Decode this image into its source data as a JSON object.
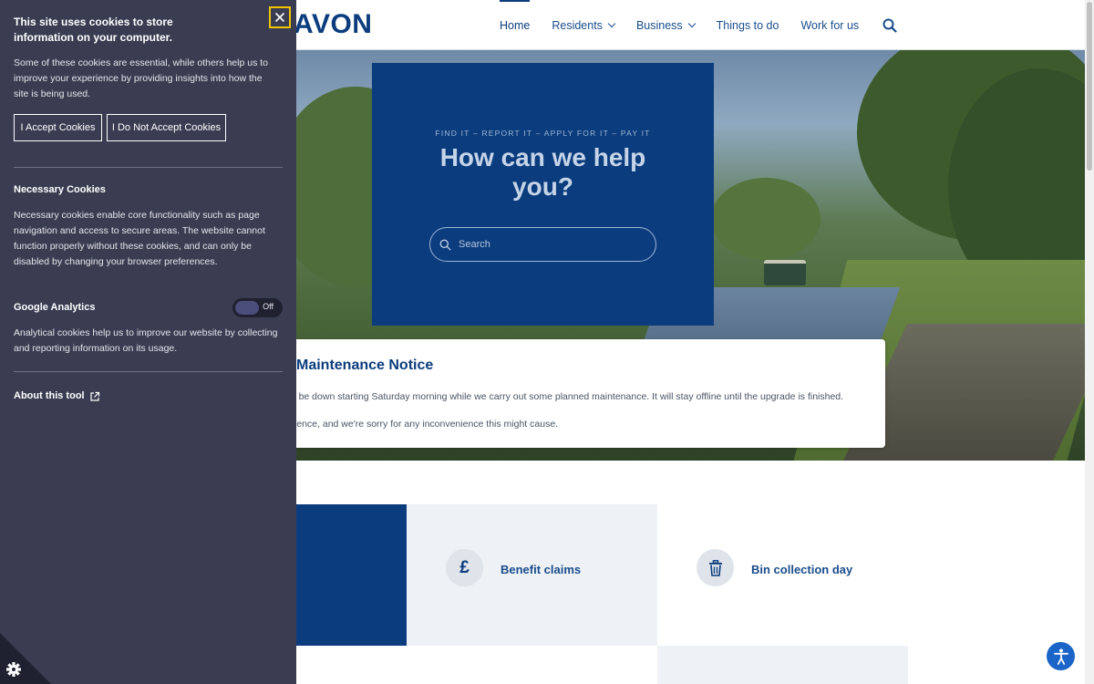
{
  "header": {
    "logo_text": "AVON",
    "nav": [
      {
        "label": "Home",
        "dropdown": false,
        "active": true
      },
      {
        "label": "Residents",
        "dropdown": true,
        "active": false
      },
      {
        "label": "Business",
        "dropdown": true,
        "active": false
      },
      {
        "label": "Things to do",
        "dropdown": false,
        "active": false
      },
      {
        "label": "Work for us",
        "dropdown": false,
        "active": false
      }
    ],
    "search_icon": "search-icon"
  },
  "hero": {
    "eyebrow": "FIND IT – REPORT IT – APPLY FOR IT – PAY IT",
    "title": "How can we help you?",
    "search_placeholder": "Search"
  },
  "notice": {
    "title": "Maintenance Notice",
    "paragraph_1": "ll be down starting Saturday morning while we carry out some planned maintenance. It will stay offline until the upgrade is finished.",
    "paragraph_2": "tience, and we're sorry for any inconvenience this might cause."
  },
  "tiles": [
    {
      "label": "Benefit claims",
      "icon": "pound-icon",
      "glyph": "£"
    },
    {
      "label": "Bin collection day",
      "icon": "bin-icon"
    }
  ],
  "cookie_panel": {
    "heading": "This site uses cookies to store information on your computer.",
    "intro": "Some of these cookies are essential, while others help us to improve your experience by providing insights into how the site is being used.",
    "accept_label": "I Accept Cookies",
    "reject_label": "I Do Not Accept Cookies",
    "necessary_title": "Necessary Cookies",
    "necessary_text": "Necessary cookies enable core functionality such as page navigation and access to secure areas. The website cannot function properly without these cookies, and can only be disabled by changing your browser preferences.",
    "analytics_title": "Google Analytics",
    "analytics_toggle": "Off",
    "analytics_text": "Analytical cookies help us to improve our website by collecting and reporting information on its usage.",
    "about_label": "About this tool"
  },
  "colors": {
    "brand_blue": "#0b3c7d",
    "panel_bg": "#3a3d52",
    "close_outline": "#f2c200",
    "a11y_blue": "#1b64c8"
  }
}
